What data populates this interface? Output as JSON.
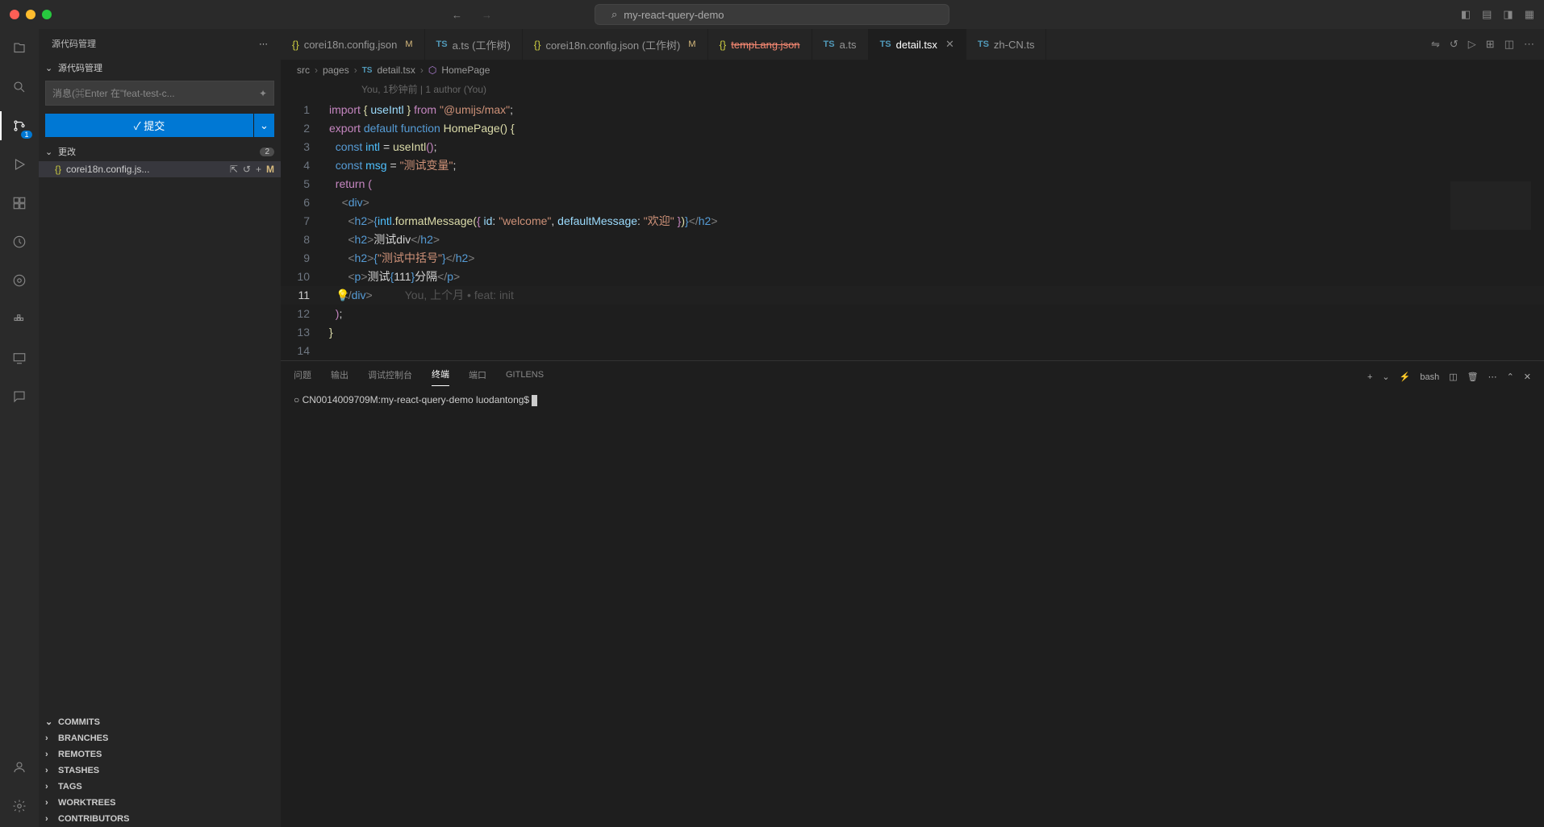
{
  "title": "my-react-query-demo",
  "sidebar": {
    "title": "源代码管理",
    "section": "源代码管理",
    "msg_placeholder": "消息(⌘Enter 在\"feat-test-c...",
    "commit_label": "✓ 提交",
    "changes_label": "更改",
    "changes_count": "2",
    "change_file": "corei18n.config.js...",
    "change_badge": "M",
    "scm_badge": "1",
    "gitlens": [
      "COMMITS",
      "BRANCHES",
      "REMOTES",
      "STASHES",
      "TAGS",
      "WORKTREES",
      "CONTRIBUTORS"
    ]
  },
  "tabs": [
    {
      "icon": "json",
      "label": "corei18n.config.json",
      "mod": "M"
    },
    {
      "icon": "ts",
      "label": "a.ts (工作树)"
    },
    {
      "icon": "json",
      "label": "corei18n.config.json (工作树)",
      "mod": "M"
    },
    {
      "icon": "json",
      "label": "tempLang.json",
      "strike": true
    },
    {
      "icon": "ts",
      "label": "a.ts"
    },
    {
      "icon": "ts",
      "label": "detail.tsx",
      "active": true,
      "close": true
    },
    {
      "icon": "ts",
      "label": "zh-CN.ts"
    }
  ],
  "breadcrumb": [
    "src",
    "pages",
    "detail.tsx",
    "HomePage"
  ],
  "codelens": "You, 1秒钟前 | 1 author (You)",
  "blame": "You, 上个月 • feat: init",
  "code_lines": [
    "1",
    "2",
    "3",
    "4",
    "5",
    "6",
    "7",
    "8",
    "9",
    "10",
    "11",
    "12",
    "13",
    "14"
  ],
  "panel": {
    "tabs": [
      "问题",
      "输出",
      "调试控制台",
      "终端",
      "端口",
      "GITLENS"
    ],
    "active": "终端",
    "term_type": "bash",
    "prompt": "CN0014009709M:my-react-query-demo luodantong$ "
  }
}
